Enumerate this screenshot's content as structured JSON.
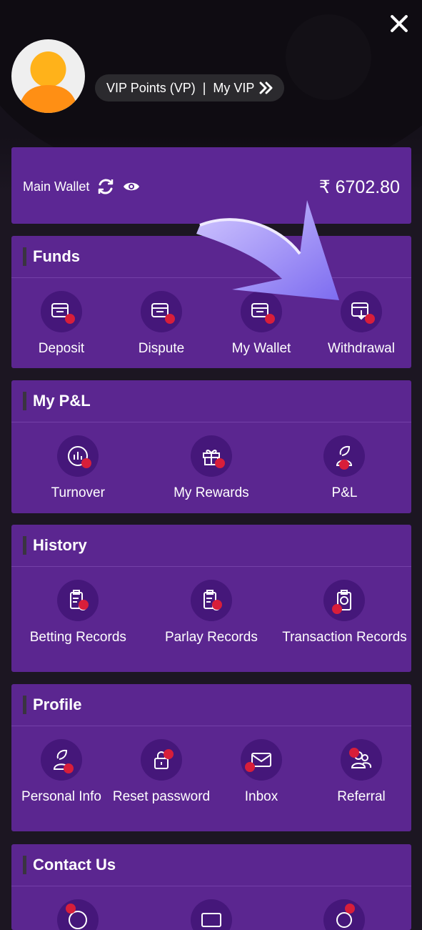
{
  "header": {
    "vip_points_label": "VIP Points (VP)",
    "separator": "|",
    "my_vip_label": "My VIP"
  },
  "wallet": {
    "label": "Main Wallet",
    "amount": "₹ 6702.80"
  },
  "sections": {
    "funds": {
      "title": "Funds",
      "items": [
        {
          "label": "Deposit",
          "icon": "deposit-icon"
        },
        {
          "label": "Dispute",
          "icon": "dispute-icon"
        },
        {
          "label": "My Wallet",
          "icon": "wallet-icon"
        },
        {
          "label": "Withdrawal",
          "icon": "withdrawal-icon"
        }
      ]
    },
    "pl": {
      "title": "My P&L",
      "items": [
        {
          "label": "Turnover",
          "icon": "turnover-icon"
        },
        {
          "label": "My Rewards",
          "icon": "gift-icon"
        },
        {
          "label": "P&L",
          "icon": "profile-leaf-icon"
        }
      ]
    },
    "history": {
      "title": "History",
      "items": [
        {
          "label": "Betting Records",
          "icon": "betting-records-icon"
        },
        {
          "label": "Parlay Records",
          "icon": "parlay-records-icon"
        },
        {
          "label": "Transaction Records",
          "icon": "transaction-records-icon"
        }
      ]
    },
    "profile": {
      "title": "Profile",
      "items": [
        {
          "label": "Personal Info",
          "icon": "person-icon"
        },
        {
          "label": "Reset password",
          "icon": "lock-icon"
        },
        {
          "label": "Inbox",
          "icon": "mail-icon"
        },
        {
          "label": "Referral",
          "icon": "referral-icon"
        }
      ]
    },
    "contact": {
      "title": "Contact Us"
    }
  },
  "colors": {
    "card": "#5b2690",
    "icon_bg": "#45177a",
    "accent_dot": "#d81e3a",
    "avatar": "#ff9f1a"
  }
}
